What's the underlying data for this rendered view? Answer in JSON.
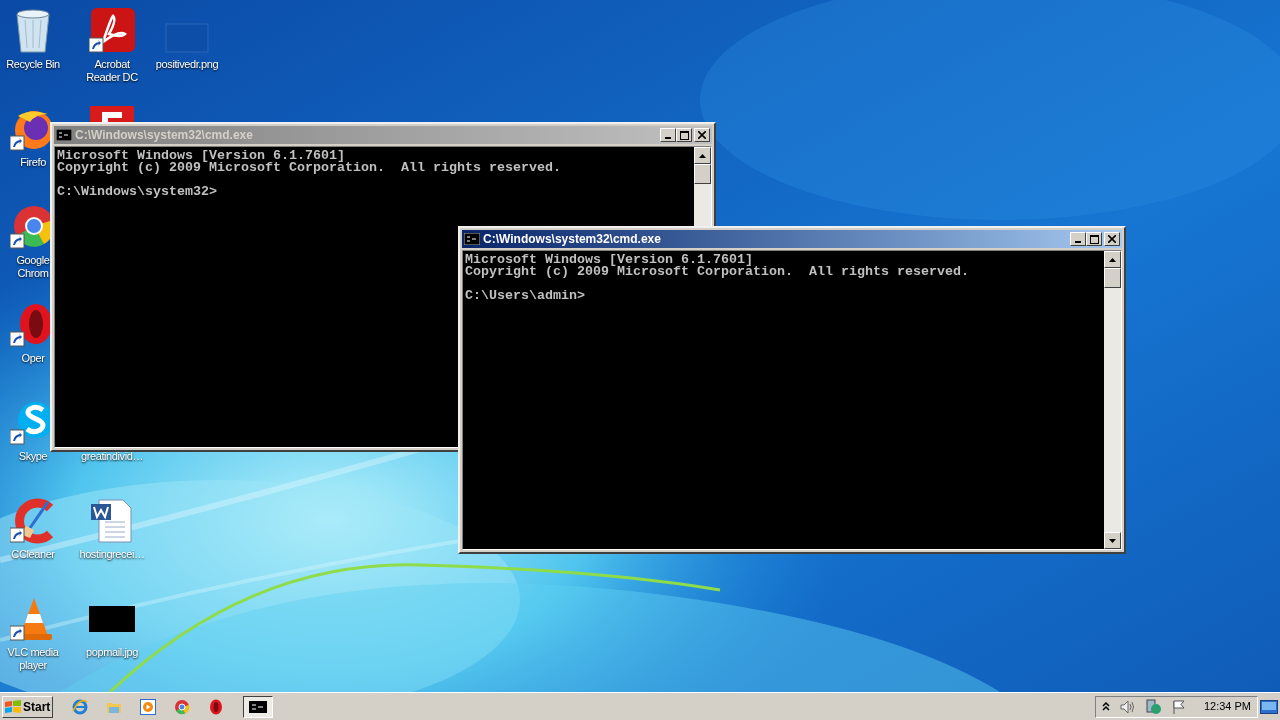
{
  "desktop_icons": [
    {
      "label": "Recycle Bin",
      "kind": "recycle-bin"
    },
    {
      "label": "Firefo",
      "kind": "firefox"
    },
    {
      "label": "Google Chrom",
      "kind": "chrome"
    },
    {
      "label": "Oper",
      "kind": "opera"
    },
    {
      "label": "Skype",
      "kind": "skype"
    },
    {
      "label": "CCleaner",
      "kind": "ccleaner"
    },
    {
      "label": "VLC media player",
      "kind": "vlc"
    },
    {
      "label": "Acrobat Reader DC",
      "kind": "pdf"
    },
    {
      "kind": "red-app"
    },
    {
      "label": "greatindivid…",
      "kind": "hidden"
    },
    {
      "label": "hostingrecei…",
      "kind": "word"
    },
    {
      "label": "popmail.jpg",
      "kind": "image-dark"
    },
    {
      "label": "positivedr.png",
      "kind": "image-blue"
    }
  ],
  "windows": [
    {
      "title": "C:\\Windows\\system32\\cmd.exe",
      "active": false,
      "output": [
        "Microsoft Windows [Version 6.1.7601]",
        "Copyright (c) 2009 Microsoft Corporation.  All rights reserved."
      ],
      "prompt": "C:\\Windows\\system32>"
    },
    {
      "title": "C:\\Windows\\system32\\cmd.exe",
      "active": true,
      "output": [
        "Microsoft Windows [Version 6.1.7601]",
        "Copyright (c) 2009 Microsoft Corporation.  All rights reserved."
      ],
      "prompt": "C:\\Users\\admin>"
    }
  ],
  "taskbar": {
    "start": "Start",
    "quick_launch": [
      {
        "kind": "ie"
      },
      {
        "kind": "explorer"
      },
      {
        "kind": "media"
      },
      {
        "kind": "chrome"
      },
      {
        "kind": "opera"
      }
    ],
    "tasks": [
      {
        "kind": "cmd",
        "selected": true
      }
    ],
    "tray": {
      "clock": "12:34 PM"
    }
  }
}
